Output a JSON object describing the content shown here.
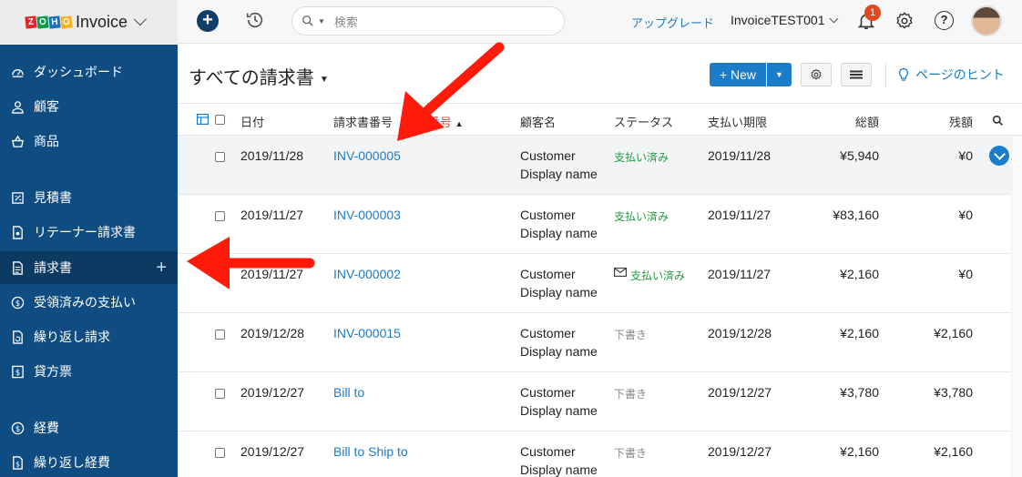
{
  "app": {
    "brand_letters": [
      "Z",
      "O",
      "H",
      "O"
    ],
    "brand_colors": [
      "#e42527",
      "#089949",
      "#226db4",
      "#f9b21d"
    ],
    "name": "Invoice"
  },
  "topbar": {
    "search_placeholder": "検索",
    "upgrade": "アップグレード",
    "org_name": "InvoiceTEST001",
    "notification_count": "1",
    "help_glyph": "?",
    "icons": [
      "plus-icon",
      "history-icon",
      "search-icon",
      "bell-icon",
      "gear-icon",
      "help-icon",
      "avatar"
    ]
  },
  "sidebar": {
    "items": [
      {
        "label": "ダッシュボード",
        "icon": "dashboard-icon"
      },
      {
        "label": "顧客",
        "icon": "user-icon"
      },
      {
        "label": "商品",
        "icon": "basket-icon"
      },
      {
        "label": "見積書",
        "icon": "estimate-icon"
      },
      {
        "label": "リテーナー請求書",
        "icon": "retainer-icon"
      },
      {
        "label": "請求書",
        "icon": "invoice-icon",
        "active": true,
        "plus": "+"
      },
      {
        "label": "受領済みの支払い",
        "icon": "payment-icon"
      },
      {
        "label": "繰り返し請求",
        "icon": "recurring-icon"
      },
      {
        "label": "貸方票",
        "icon": "credit-note-icon"
      },
      {
        "label": "経費",
        "icon": "expense-icon"
      },
      {
        "label": "繰り返し経費",
        "icon": "recurring-expense-icon"
      }
    ]
  },
  "main": {
    "title": "すべての請求書",
    "title_caret": "▼",
    "new_button": "+ New",
    "split_caret": "▼",
    "hint": "ページのヒント"
  },
  "table": {
    "headers": {
      "date": "日付",
      "invoice_no": "請求書番号",
      "order_no": "注文番号",
      "sort_arrow": "▲",
      "customer": "顧客名",
      "status": "ステータス",
      "due": "支払い期限",
      "total": "総額",
      "balance": "残額"
    },
    "rows": [
      {
        "date": "2019/11/28",
        "number": "INV-000005",
        "customer_1": "Customer",
        "customer_2": "Display name",
        "status": "支払い済み",
        "status_type": "paid",
        "due": "2019/11/28",
        "total": "¥5,940",
        "balance": "¥0"
      },
      {
        "date": "2019/11/27",
        "number": "INV-000003",
        "customer_1": "Customer",
        "customer_2": "Display name",
        "status": "支払い済み",
        "status_type": "paid",
        "due": "2019/11/27",
        "total": "¥83,160",
        "balance": "¥0"
      },
      {
        "date": "2019/11/27",
        "number": "INV-000002",
        "customer_1": "Customer",
        "customer_2": "Display name",
        "status": "支払い済み",
        "status_type": "paid",
        "mail": true,
        "due": "2019/11/27",
        "total": "¥2,160",
        "balance": "¥0"
      },
      {
        "date": "2019/12/28",
        "number": "INV-000015",
        "customer_1": "Customer",
        "customer_2": "Display name",
        "status": "下書き",
        "status_type": "draft",
        "due": "2019/12/28",
        "total": "¥2,160",
        "balance": "¥2,160"
      },
      {
        "date": "2019/12/27",
        "number": "Bill to",
        "customer_1": "Customer",
        "customer_2": "Display name",
        "status": "下書き",
        "status_type": "draft",
        "due": "2019/12/27",
        "total": "¥3,780",
        "balance": "¥3,780"
      },
      {
        "date": "2019/12/27",
        "number": "Bill to Ship to",
        "customer_1": "Customer",
        "customer_2": "Display name",
        "status": "下書き",
        "status_type": "draft",
        "due": "2019/12/27",
        "total": "¥2,160",
        "balance": "¥2,160"
      }
    ]
  },
  "annotations": {
    "arrow_color": "#ff1a0a"
  }
}
